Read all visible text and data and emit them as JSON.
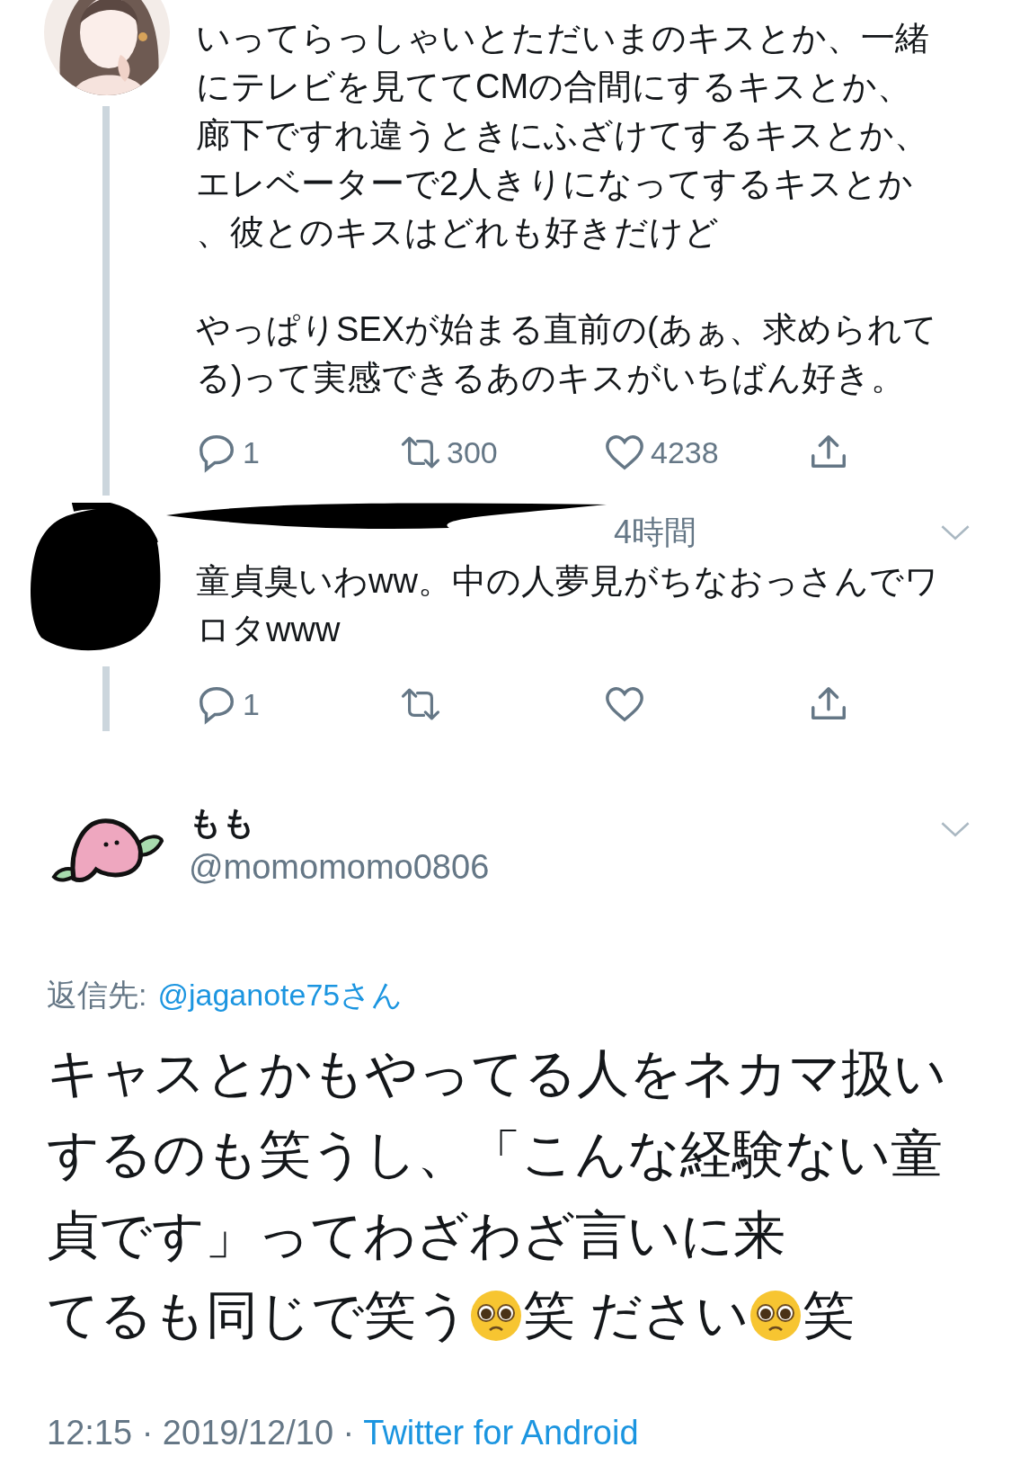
{
  "thread": [
    {
      "avatar": {
        "kind": "picture"
      },
      "paragraphs": [
        "いってらっしゃいとただいまのキスとか、一緒にテレビを見ててCMの合間にするキスとか、廊下ですれ違うときにふざけてするキスとか、エレベーターで2人きりになってするキスとか、彼とのキスはどれも好きだけど",
        "やっぱりSEXが始まる直前の(あぁ、求められてる)って実感できるあのキスがいちばん好き。"
      ],
      "actions": [
        {
          "kind": "reply",
          "count": "1"
        },
        {
          "kind": "retweet",
          "count": "300"
        },
        {
          "kind": "like",
          "count": "4238"
        },
        {
          "kind": "share"
        }
      ]
    },
    {
      "avatar": {
        "kind": "redacted"
      },
      "time": "4時間",
      "paragraphs": [
        "童貞臭いわww。中の人夢見がちなおっさんでワロタwww"
      ],
      "actions": [
        {
          "kind": "reply",
          "count": "1"
        },
        {
          "kind": "retweet"
        },
        {
          "kind": "like"
        },
        {
          "kind": "share"
        }
      ]
    }
  ],
  "tweet": {
    "name": "もも",
    "handle": "@momomomo0806",
    "reply_to": {
      "label": "返信先:",
      "handle": "@jaganote75さん"
    },
    "body": {
      "text": "キャスとかもやってる人をネカマ扱いするのも笑うし、「こんな経験ない童貞です」ってわざわざ言いに来",
      "tail": [
        {
          "kind": "text",
          "text": "てるも同じで笑う"
        },
        {
          "kind": "emoji"
        },
        {
          "kind": "text",
          "text": "笑 ださい"
        },
        {
          "kind": "emoji"
        },
        {
          "kind": "text",
          "text": "笑"
        }
      ]
    },
    "footer": {
      "meta": "12:15 · 2019/12/10 ·",
      "source": "Twitter for Android"
    }
  }
}
